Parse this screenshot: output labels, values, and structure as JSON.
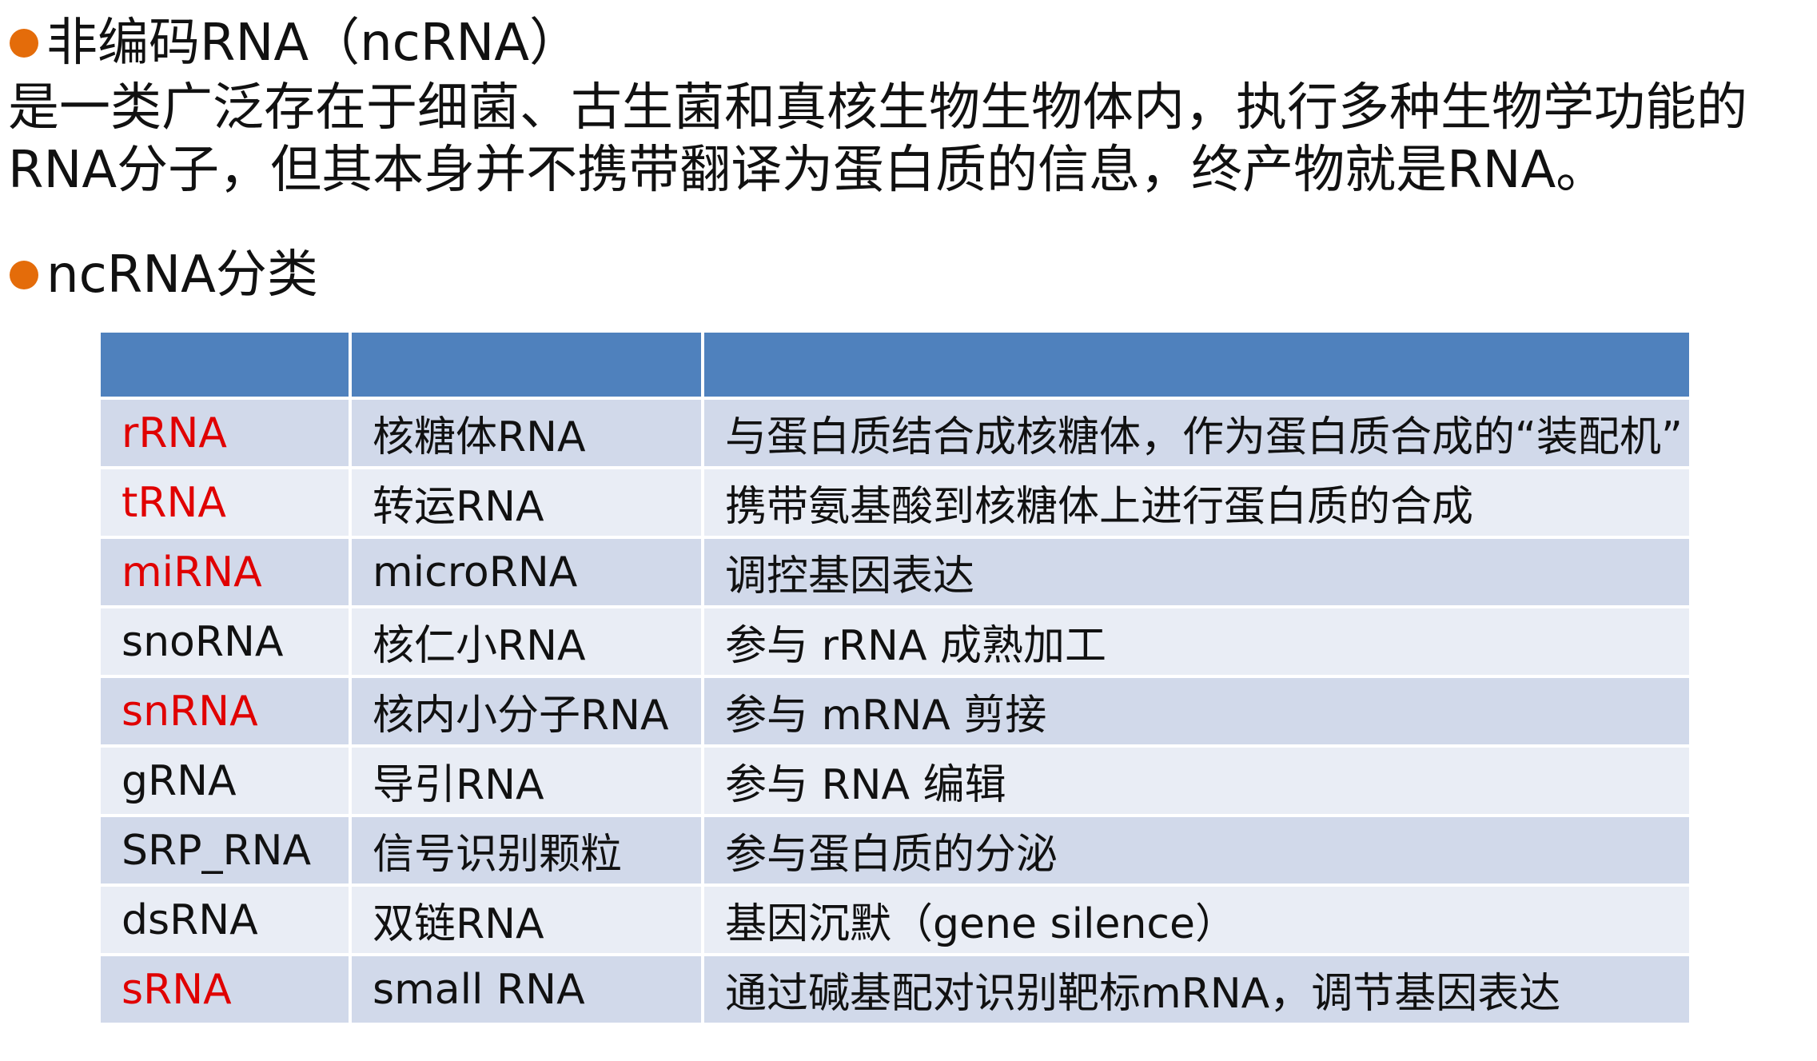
{
  "colors": {
    "bullet": "#e46c0a",
    "header": "#4f81bd",
    "row_odd": "#d1d9ea",
    "row_even": "#e9edf5",
    "highlight_red": "#e00000",
    "text": "#111111"
  },
  "section1": {
    "title": "非编码RNA（ncRNA）",
    "lines": [
      "是一类广泛存在于细菌、古生菌和真核生物生物体内，执行多种生物学功能的",
      "RNA分子，但其本身并不携带翻译为蛋白质的信息，终产物就是RNA。"
    ]
  },
  "section2": {
    "title": "ncRNA分类"
  },
  "table": {
    "headers": [
      "",
      "",
      ""
    ],
    "rows": [
      {
        "abbr": "rRNA",
        "name": "核糖体RNA",
        "function": "与蛋白质结合成核糖体，作为蛋白质合成的“装配机”",
        "red": true
      },
      {
        "abbr": "tRNA",
        "name": "转运RNA",
        "function": "携带氨基酸到核糖体上进行蛋白质的合成",
        "red": true
      },
      {
        "abbr": "miRNA",
        "name": "microRNA",
        "function": "调控基因表达",
        "red": true
      },
      {
        "abbr": "snoRNA",
        "name": "核仁小RNA",
        "function": "参与 rRNA 成熟加工",
        "red": false
      },
      {
        "abbr": "snRNA",
        "name": "核内小分子RNA",
        "function": "参与 mRNA 剪接",
        "red": true
      },
      {
        "abbr": "gRNA",
        "name": "导引RNA",
        "function": "参与 RNA 编辑",
        "red": false
      },
      {
        "abbr": "SRP_RNA",
        "name": "信号识别颗粒",
        "function": "参与蛋白质的分泌",
        "red": false
      },
      {
        "abbr": "dsRNA",
        "name": "双链RNA",
        "function": "基因沉默（gene silence）",
        "red": false
      },
      {
        "abbr": "sRNA",
        "name": "small RNA",
        "function": "通过碱基配对识别靶标mRNA，调节基因表达",
        "red": true
      }
    ]
  }
}
